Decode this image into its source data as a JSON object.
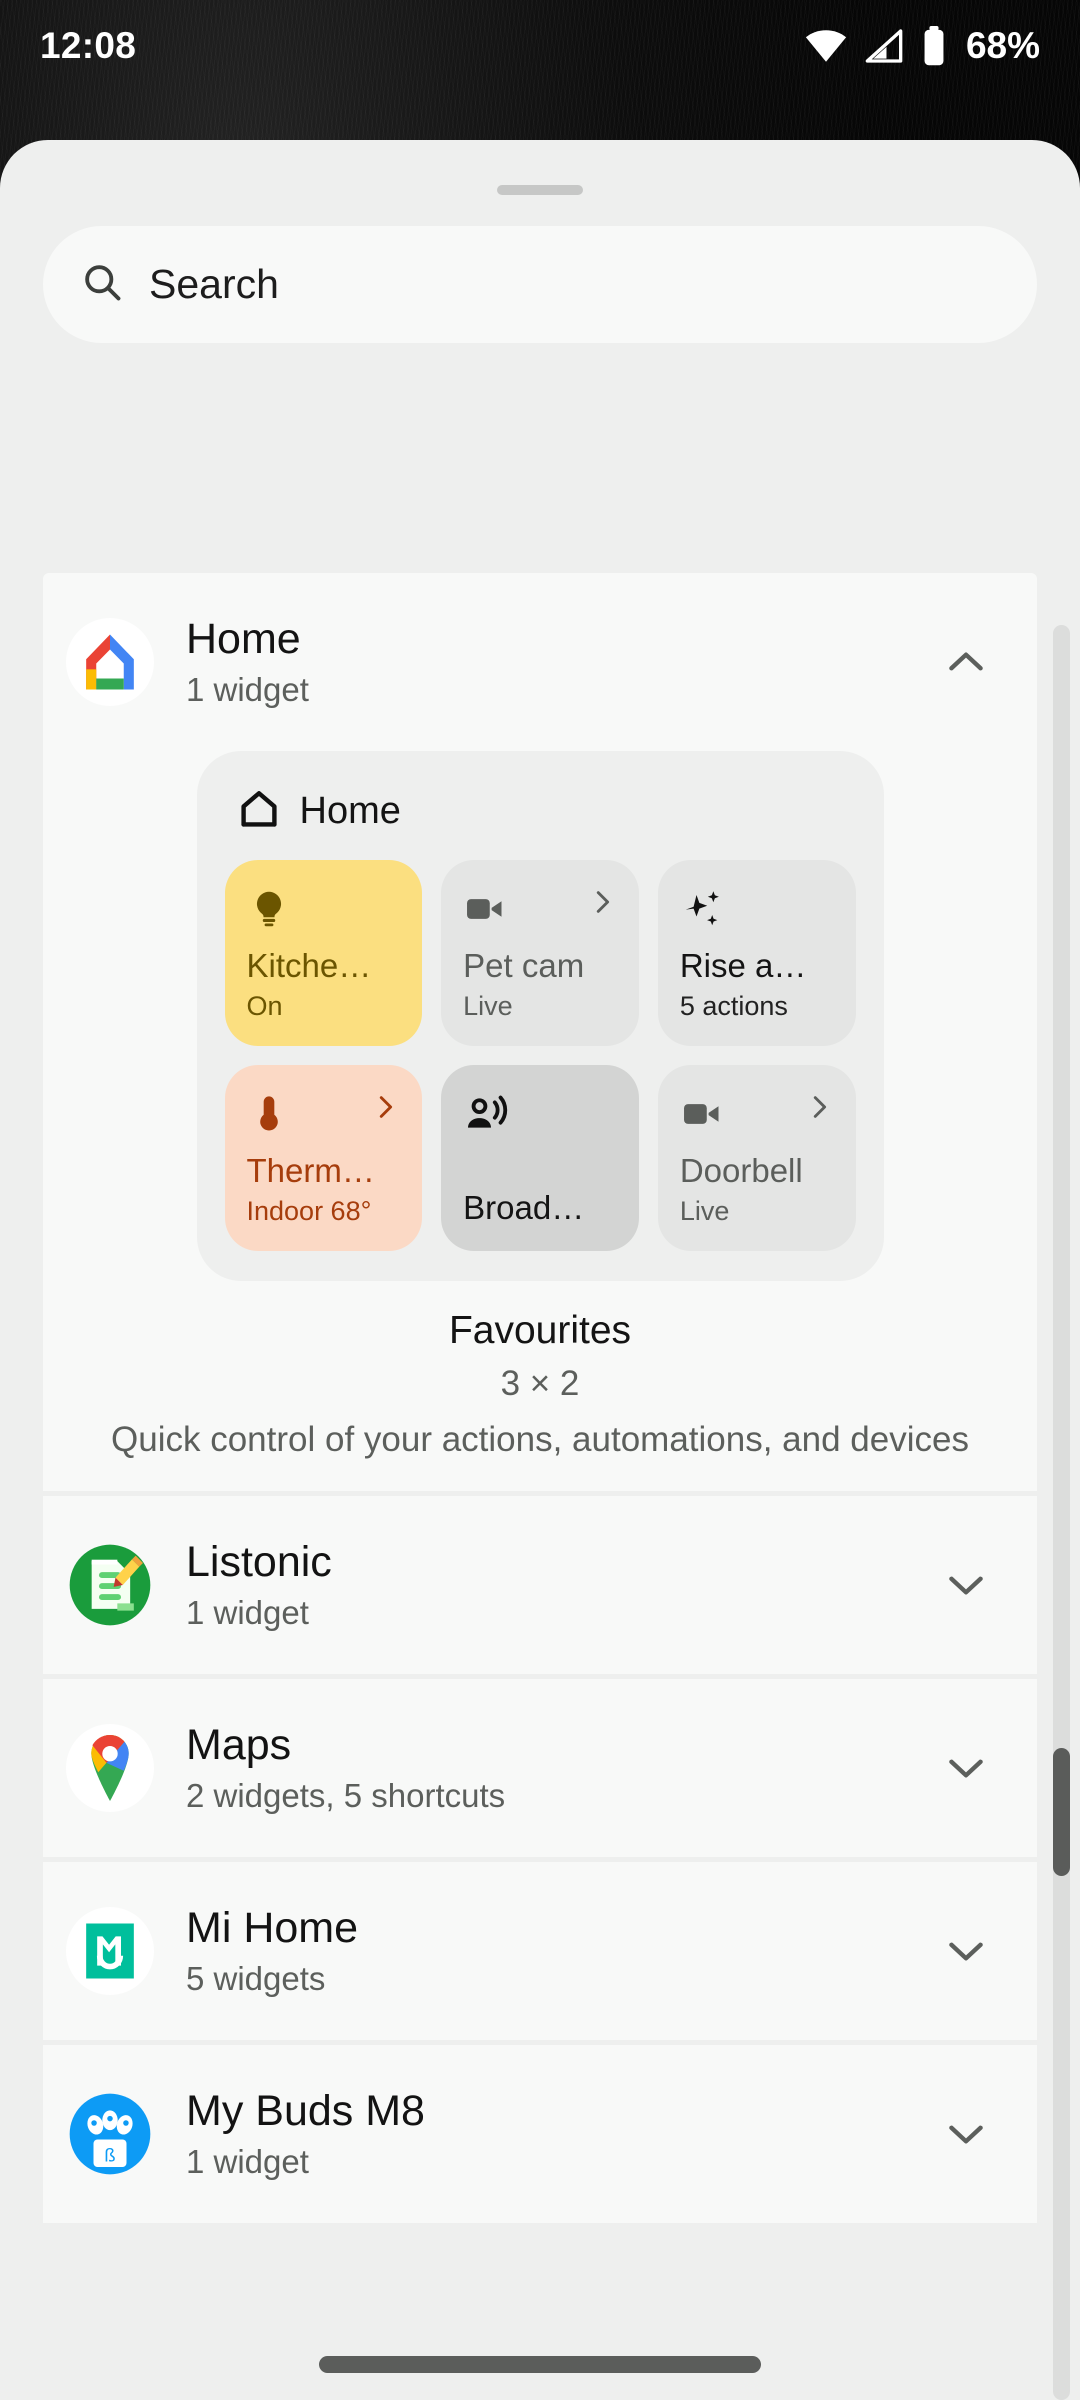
{
  "status_bar": {
    "time": "12:08",
    "battery_percent": "68%",
    "icons": [
      "wifi-icon",
      "cellular-signal-icon",
      "battery-icon"
    ]
  },
  "sheet": {
    "drag_handle": "drag-handle"
  },
  "search": {
    "placeholder": "Search",
    "icon": "search-icon"
  },
  "apps": [
    {
      "name": "Home",
      "subtitle": "1 widget",
      "icon": "google-home-icon",
      "expanded": true,
      "chevron": "chevron-up-icon"
    },
    {
      "name": "Listonic",
      "subtitle": "1 widget",
      "icon": "listonic-icon",
      "expanded": false,
      "chevron": "chevron-down-icon"
    },
    {
      "name": "Maps",
      "subtitle": "2 widgets, 5 shortcuts",
      "icon": "google-maps-icon",
      "expanded": false,
      "chevron": "chevron-down-icon"
    },
    {
      "name": "Mi Home",
      "subtitle": "5 widgets",
      "icon": "mi-home-icon",
      "expanded": false,
      "chevron": "chevron-down-icon"
    },
    {
      "name": "My Buds M8",
      "subtitle": "1 widget",
      "icon": "my-buds-icon",
      "expanded": false,
      "chevron": "chevron-down-icon"
    }
  ],
  "widget_preview": {
    "header_label": "Home",
    "header_icon": "home-outline-icon",
    "tiles": [
      {
        "name": "Kitche…",
        "state": "On",
        "icon": "lightbulb-icon",
        "has_arrow": false,
        "style": "yellow"
      },
      {
        "name": "Pet cam",
        "state": "Live",
        "icon": "videocam-icon",
        "has_arrow": true,
        "style": "grey"
      },
      {
        "name": "Rise a…",
        "state": "5 actions",
        "icon": "sparkles-icon",
        "has_arrow": false,
        "style": "grey"
      },
      {
        "name": "Therm…",
        "state": "Indoor 68°",
        "icon": "thermometer-icon",
        "has_arrow": true,
        "style": "peach"
      },
      {
        "name": "Broad…",
        "state": "",
        "icon": "broadcast-icon",
        "has_arrow": false,
        "style": "dark"
      },
      {
        "name": "Doorbell",
        "state": "Live",
        "icon": "videocam-icon",
        "has_arrow": true,
        "style": "grey"
      }
    ],
    "info": {
      "title": "Favourites",
      "size": "3 × 2",
      "description": "Quick control of your actions, automations, and devices"
    }
  },
  "colors": {
    "sheet_background": "#eeefee",
    "card_background": "#f8f9f8",
    "tile_yellow": "#fbdf80",
    "tile_yellow_fg": "#6b5500",
    "tile_grey": "#e4e5e4",
    "tile_grey_fg": "#5b5e5b",
    "tile_peach": "#fbd9c5",
    "tile_peach_fg": "#a63d0c",
    "tile_dark": "#d3d4d3",
    "text_primary": "#131313",
    "text_secondary": "#5c5f5c",
    "scrollbar_thumb": "#5a5c5a"
  }
}
